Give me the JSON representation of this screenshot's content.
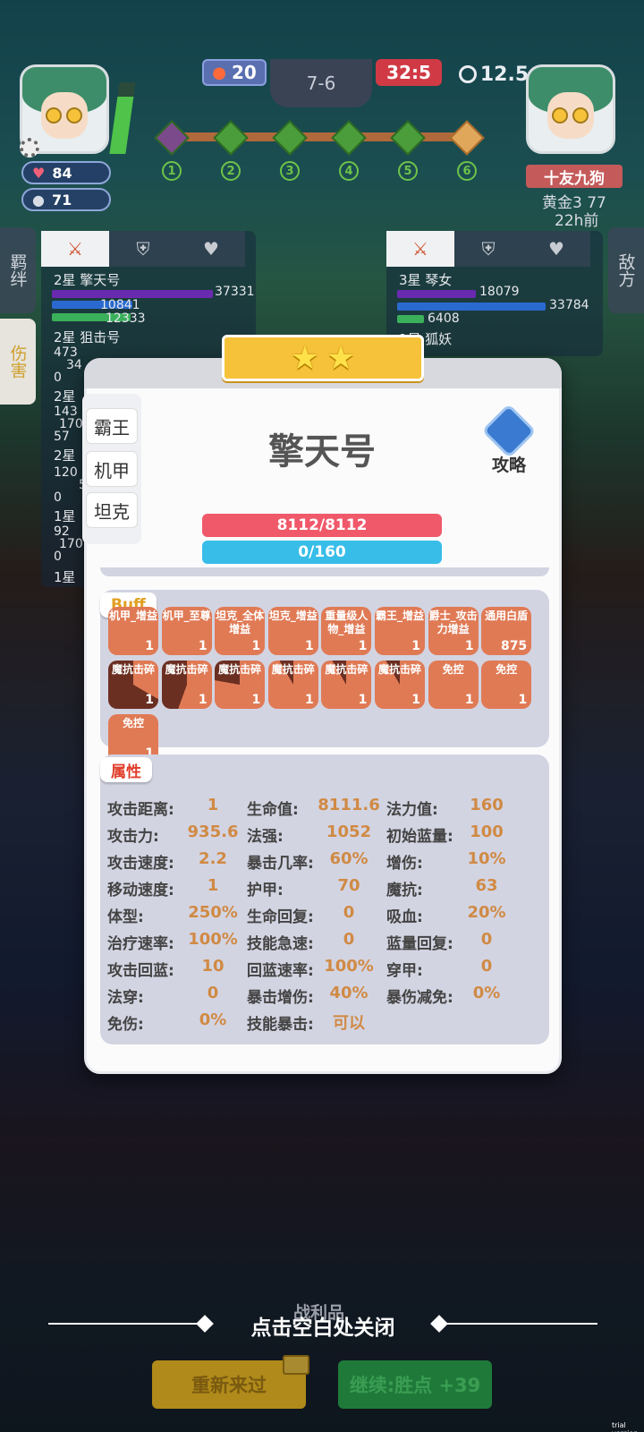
{
  "top": {
    "hp_left": "20",
    "round": "7-6",
    "score_right": "32:5",
    "timer": "12.5",
    "rounds": [
      "1",
      "2",
      "3",
      "4",
      "5",
      "6"
    ]
  },
  "player_left": {
    "health": "84",
    "coins": "71"
  },
  "player_right": {
    "name": "十友九狗",
    "rank": "黄金3 77",
    "time_ago": "22h前"
  },
  "left_side": {
    "tabs": [
      "羁绊",
      "伤害"
    ],
    "unit1": {
      "name": "2星 擎天号",
      "v1": "37331",
      "v2": "10841",
      "v3": "12333"
    },
    "unit2": {
      "name": "2星 狙击号",
      "v1": "473",
      "v2": "34",
      "v3": "0"
    },
    "rows": [
      "2星",
      "143",
      "170",
      "57",
      "2星",
      "120",
      "5",
      "0",
      "1星",
      "92",
      "170",
      "0",
      "1星"
    ]
  },
  "right_side": {
    "tab": "敌方",
    "unit1": {
      "name": "3星 琴女",
      "v1": "18079",
      "v2": "33784",
      "v3": "6408"
    },
    "unit2": {
      "name": "1星 狐妖"
    }
  },
  "modal": {
    "stars": 2,
    "unit_name": "擎天号",
    "traits": [
      "霸王",
      "机甲",
      "坦克"
    ],
    "guide_label": "攻略",
    "hp": "8112/8112",
    "mana": "0/160",
    "buff_tag": "Buff",
    "buffs": [
      {
        "label": "机甲_增益",
        "count": "1"
      },
      {
        "label": "机甲_至尊",
        "count": "1"
      },
      {
        "label": "坦克_全体增益",
        "count": "1"
      },
      {
        "label": "坦克_增益",
        "count": "1"
      },
      {
        "label": "重量级人物_增益",
        "count": "1"
      },
      {
        "label": "霸王_增益",
        "count": "1"
      },
      {
        "label": "爵士_攻击力增益",
        "count": "1"
      },
      {
        "label": "通用白盾",
        "count": "875"
      },
      {
        "label": "魔抗击碎",
        "count": "1"
      },
      {
        "label": "魔抗击碎",
        "count": "1"
      },
      {
        "label": "魔抗击碎",
        "count": "1"
      },
      {
        "label": "魔抗击碎",
        "count": "1"
      },
      {
        "label": "魔抗击碎",
        "count": "1"
      },
      {
        "label": "魔抗击碎",
        "count": "1"
      },
      {
        "label": "免控",
        "count": "1"
      },
      {
        "label": "免控",
        "count": "1"
      },
      {
        "label": "免控",
        "count": "1"
      }
    ],
    "attr_tag": "属性",
    "attrs": [
      {
        "k": "攻击距离:",
        "v": "1"
      },
      {
        "k": "生命值:",
        "v": "8111.6"
      },
      {
        "k": "法力值:",
        "v": "160"
      },
      {
        "k": "攻击力:",
        "v": "935.6"
      },
      {
        "k": "法强:",
        "v": "1052"
      },
      {
        "k": "初始蓝量:",
        "v": "100"
      },
      {
        "k": "攻击速度:",
        "v": "2.2"
      },
      {
        "k": "暴击几率:",
        "v": "60%"
      },
      {
        "k": "增伤:",
        "v": "10%"
      },
      {
        "k": "移动速度:",
        "v": "1"
      },
      {
        "k": "护甲:",
        "v": "70"
      },
      {
        "k": "魔抗:",
        "v": "63"
      },
      {
        "k": "体型:",
        "v": "250%"
      },
      {
        "k": "生命回复:",
        "v": "0"
      },
      {
        "k": "吸血:",
        "v": "20%"
      },
      {
        "k": "治疗速率:",
        "v": "100%"
      },
      {
        "k": "技能急速:",
        "v": "0"
      },
      {
        "k": "蓝量回复:",
        "v": "0"
      },
      {
        "k": "攻击回蓝:",
        "v": "10"
      },
      {
        "k": "回蓝速率:",
        "v": "100%"
      },
      {
        "k": "穿甲:",
        "v": "0"
      },
      {
        "k": "法穿:",
        "v": "0"
      },
      {
        "k": "暴击增伤:",
        "v": "40%"
      },
      {
        "k": "暴伤减免:",
        "v": "0%"
      },
      {
        "k": "免伤:",
        "v": "0%"
      },
      {
        "k": "技能暴击:",
        "v": "可以"
      }
    ]
  },
  "bottom": {
    "loot_label": "战利品",
    "close_hint": "点击空白处关闭",
    "retry_label": "重新来过",
    "continue_label": "继续:胜点 +39",
    "trial": "trial version"
  },
  "colors": {
    "hp": "#f0596a",
    "mana": "#38bde9",
    "buff": "#e07a55",
    "value": "#d08a44",
    "accent": "#f6c23a"
  }
}
